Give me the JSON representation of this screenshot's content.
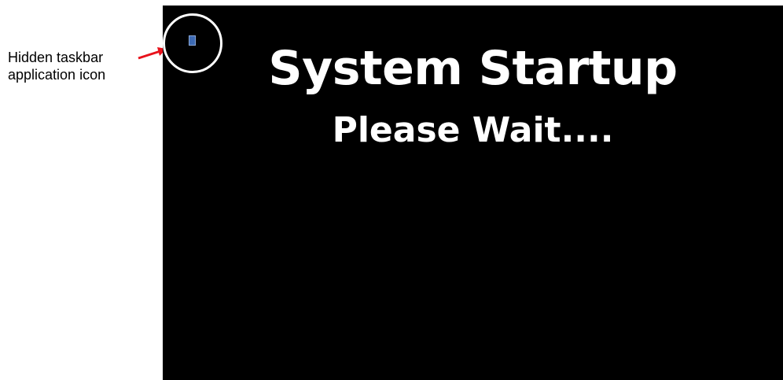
{
  "annotation": {
    "label": "Hidden taskbar application icon",
    "arrow_color": "#e8121b"
  },
  "screen": {
    "background": "#000000",
    "title": "System Startup",
    "subtitle": "Please Wait....",
    "tray_icon": {
      "name": "application-icon",
      "color": "#3d6ab3"
    },
    "highlight_color": "#ffffff"
  }
}
